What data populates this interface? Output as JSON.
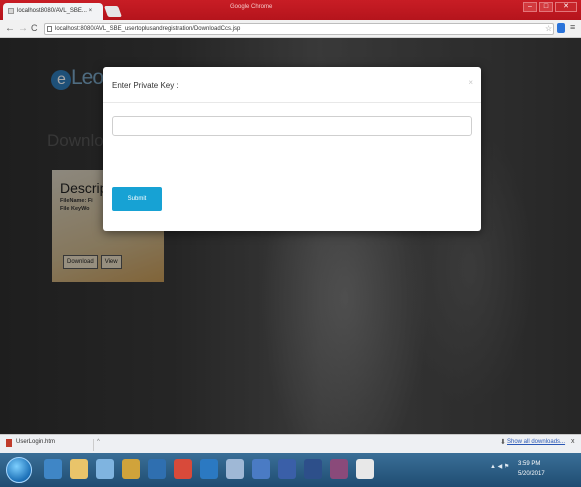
{
  "browser": {
    "tab_title": "localhost8080/AVL_SBE... ×",
    "window_title": "Google Chrome",
    "url": "localhost:8080/AVL_SBE_usertoplusandregistration/DownloadCcs.jsp",
    "back": "←",
    "forward": "→",
    "reload": "C",
    "star": "☆",
    "menu": "≡",
    "minimize": "–",
    "maximize": "□",
    "close": "✕"
  },
  "page": {
    "logo_letter": "e",
    "logo_text": "Leon",
    "heading": "Download",
    "card": {
      "title": "Descript",
      "line1": "FileName: Fi",
      "line2": "File KeyWo",
      "download_label": "Download",
      "view_label": "View"
    }
  },
  "modal": {
    "title": "Enter Private Key :",
    "close": "×",
    "input_value": "",
    "input_placeholder": "",
    "submit_label": "Submit"
  },
  "downloads": {
    "item_label": "UserLogin.htm",
    "caret": "^",
    "show_all": "Show all downloads...",
    "show_all_icon": "⬇",
    "close": "x"
  },
  "taskbar": {
    "time": "3:59 PM",
    "date": "5/20/2017",
    "tray": "▲ ◀ ⚑"
  },
  "colors": {
    "titlebar": "#c81d25",
    "submit": "#17a2d4",
    "taskbar": "#2a5a82"
  }
}
